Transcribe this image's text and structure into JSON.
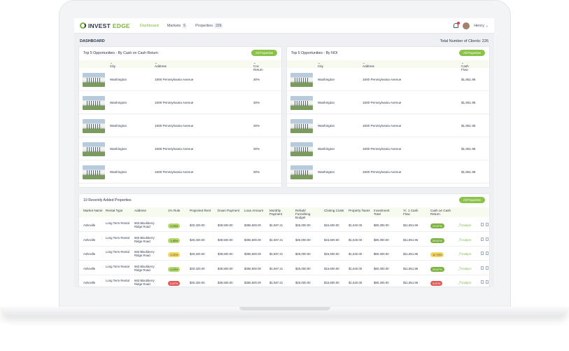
{
  "nav": {
    "logo_prefix": "INVEST",
    "logo_suffix": "EDGE",
    "links": [
      {
        "label": "Dashboard",
        "count": ""
      },
      {
        "label": "Markets",
        "count": "5"
      },
      {
        "label": "Properties",
        "count": "226"
      }
    ],
    "user": "Henry",
    "notification_count": "1"
  },
  "dashboard_title": "DASHBOARD",
  "total_clients": "Total Number of Clients: 226",
  "top_coc": {
    "title": "Top 5 Opportunities - By Cash on Cash Return",
    "button": "All Properties",
    "headers": [
      "City",
      "Address",
      "Coc Return"
    ],
    "rows": [
      {
        "city": "Washington",
        "address": "1600 Pennsylvania Avenue",
        "value": "30%"
      },
      {
        "city": "Washington",
        "address": "1600 Pennsylvania Avenue",
        "value": "30%"
      },
      {
        "city": "Washington",
        "address": "1600 Pennsylvania Avenue",
        "value": "30%"
      },
      {
        "city": "Washington",
        "address": "1600 Pennsylvania Avenue",
        "value": "30%"
      },
      {
        "city": "Washington",
        "address": "1600 Pennsylvania Avenue",
        "value": "30%"
      }
    ]
  },
  "top_noi": {
    "title": "Top 5 Opportunities - By NOI",
    "button": "All Properties",
    "headers": [
      "City",
      "Address",
      "Cash Flow"
    ],
    "rows": [
      {
        "city": "Washington",
        "address": "1600 Pennsylvania Avenue",
        "value": "$1,851.96"
      },
      {
        "city": "Washington",
        "address": "1600 Pennsylvania Avenue",
        "value": "$1,851.96"
      },
      {
        "city": "Washington",
        "address": "1600 Pennsylvania Avenue",
        "value": "$1,851.96"
      },
      {
        "city": "Washington",
        "address": "1600 Pennsylvania Avenue",
        "value": "$1,851.96"
      },
      {
        "city": "Washington",
        "address": "1600 Pennsylvania Avenue",
        "value": "$1,851.96"
      }
    ]
  },
  "recent": {
    "title": "10 Recently Added Properties",
    "button": "All Properties",
    "headers": [
      "Market Name",
      "Rental Type",
      "Address",
      "1% Rule",
      "Projected Rent",
      "Down Payment",
      "Loan Amount",
      "Monthly Payment",
      "Rehab/ Furnishing Budget",
      "Closing Costs",
      "Property Taxes",
      "Investment Total",
      "Yr. 1 Cash Flow",
      "Cash on Cash Return"
    ],
    "analyze_label": "Analyze",
    "rows": [
      {
        "market": "Asheville",
        "type": "Long Term Rental",
        "address": "693 Blackberry Ridge Road",
        "rule": "1.03%",
        "rule_class": "b-green",
        "rent": "$20,320.00",
        "down": "$39,500.00",
        "loan": "$355,500.00",
        "monthly": "$1,697.21",
        "rehab": "$25,000.00",
        "closing": "$15,600.00",
        "taxes": "$1,540.00",
        "invest": "$80,300.00",
        "cash": "$11,851.96",
        "coc": "29.67%",
        "coc_class": "b-dark"
      },
      {
        "market": "Asheville",
        "type": "Long Term Rental",
        "address": "693 Blackberry Ridge Road",
        "rule": "1.48%",
        "rule_class": "b-green",
        "rent": "$20,320.00",
        "down": "$39,500.00",
        "loan": "$355,500.00",
        "monthly": "$1,697.21",
        "rehab": "$25,000.00",
        "closing": "$15,600.00",
        "taxes": "$1,540.00",
        "invest": "$80,300.00",
        "cash": "$11,851.96",
        "coc": "29.67%",
        "coc_class": "b-dark"
      },
      {
        "market": "Asheville",
        "type": "Long Term Rental",
        "address": "693 Blackberry Ridge Road",
        "rule": "1.22%",
        "rule_class": "b-yellow",
        "rent": "$20,320.00",
        "down": "$39,500.00",
        "loan": "$355,500.00",
        "monthly": "$1,697.21",
        "rehab": "$25,000.00",
        "closing": "$15,600.00",
        "taxes": "$1,540.00",
        "invest": "$80,300.00",
        "cash": "$11,851.96",
        "coc": "11.74%",
        "coc_class": "b-yellow"
      },
      {
        "market": "Asheville",
        "type": "Long Term Rental",
        "address": "693 Blackberry Ridge Road",
        "rule": "1.03%",
        "rule_class": "b-green",
        "rent": "$20,320.00",
        "down": "$39,500.00",
        "loan": "$355,500.00",
        "monthly": "$1,697.21",
        "rehab": "$25,000.00",
        "closing": "$15,600.00",
        "taxes": "$1,540.00",
        "invest": "$80,300.00",
        "cash": "$11,851.96",
        "coc": "29.67%",
        "coc_class": "b-dark"
      },
      {
        "market": "Asheville",
        "type": "Long Term Rental",
        "address": "693 Blackberry Ridge Road",
        "rule": "0.87%",
        "rule_class": "b-red",
        "rent": "$20,320.00",
        "down": "$39,500.00",
        "loan": "$355,500.00",
        "monthly": "$1,697.21",
        "rehab": "$25,000.00",
        "closing": "$15,600.00",
        "taxes": "$1,540.00",
        "invest": "$80,300.00",
        "cash": "$11,851.96",
        "coc": "9.67%",
        "coc_class": "b-red"
      }
    ]
  }
}
